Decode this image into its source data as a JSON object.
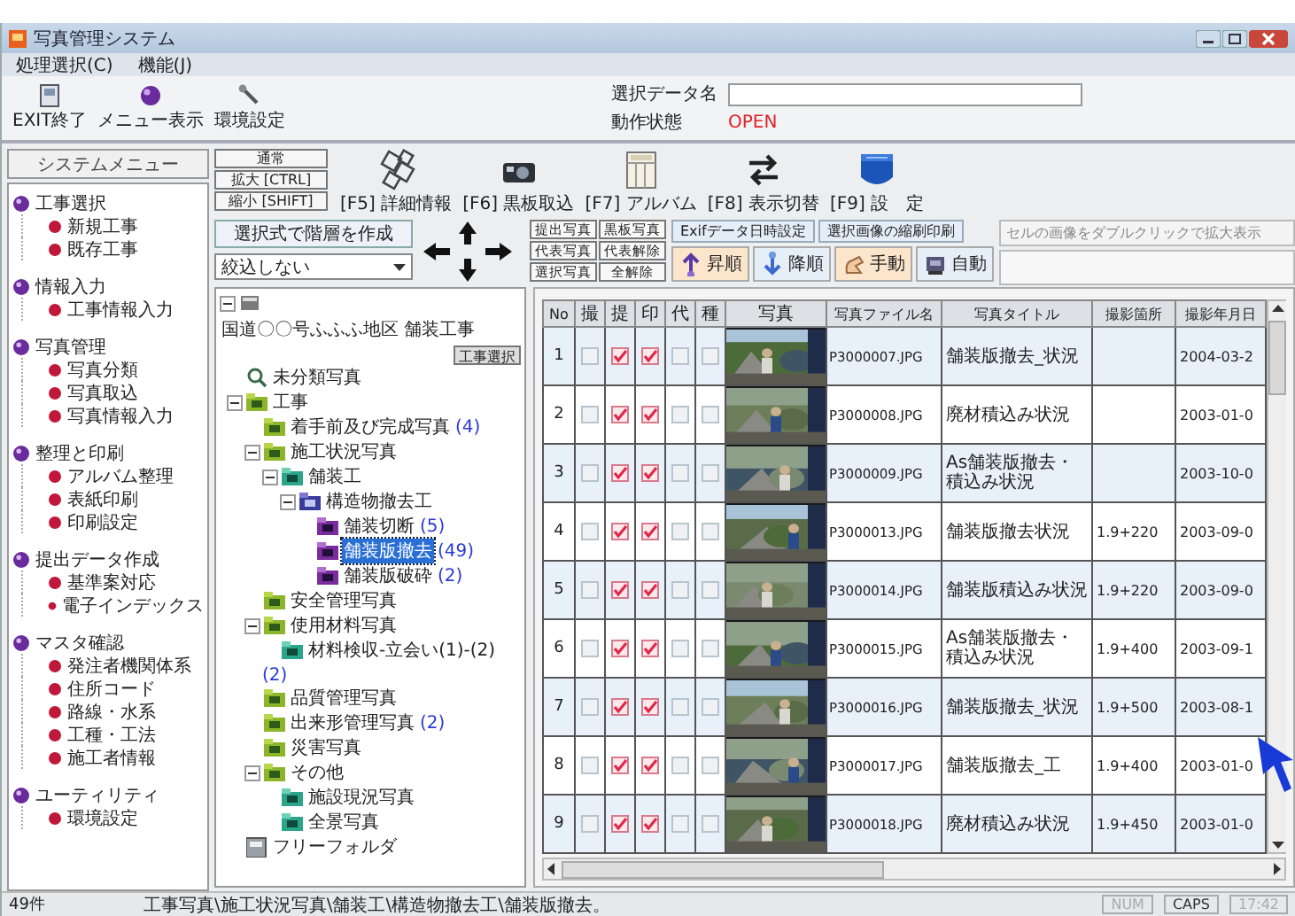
{
  "window": {
    "title": "写真管理システム"
  },
  "menu": [
    "処理選択(C)",
    "機能(J)"
  ],
  "toolbar": [
    {
      "label": "EXIT終了",
      "kind": "exit"
    },
    {
      "label": "メニュー表示",
      "kind": "menu"
    },
    {
      "label": "環境設定",
      "kind": "tools"
    }
  ],
  "selection": {
    "data_label": "選択データ名",
    "status_label": "動作状態",
    "status_value": "OPEN"
  },
  "sidebar": {
    "title": "システムメニュー",
    "groups": [
      {
        "label": "工事選択",
        "children": [
          "新規工事",
          "既存工事"
        ]
      },
      {
        "label": "情報入力",
        "children": [
          "工事情報入力"
        ]
      },
      {
        "label": "写真管理",
        "children": [
          "写真分類",
          "写真取込",
          "写真情報入力"
        ]
      },
      {
        "label": "整理と印刷",
        "children": [
          "アルバム整理",
          "表紙印刷",
          "印刷設定"
        ]
      },
      {
        "label": "提出データ作成",
        "children": [
          "基準案対応",
          "電子インデックス"
        ]
      },
      {
        "label": "マスタ確認",
        "children": [
          "発注者機関体系",
          "住所コード",
          "路線・水系",
          "工種・工法",
          "施工者情報"
        ]
      },
      {
        "label": "ユーティリティ",
        "children": [
          "環境設定"
        ]
      }
    ]
  },
  "view_buttons": [
    "通常",
    "拡大 [CTRL]",
    "縮小 [SHIFT]"
  ],
  "function_keys": [
    {
      "label": "[F5] 詳細情報",
      "kind": "detail"
    },
    {
      "label": "[F6] 黒板取込",
      "kind": "camera"
    },
    {
      "label": "[F7] アルバム",
      "kind": "album"
    },
    {
      "label": "[F8] 表示切替",
      "kind": "switch"
    },
    {
      "label": "[F9] 設　定",
      "kind": "settings"
    }
  ],
  "hierarchy_button": "選択式で階層を作成",
  "filter": {
    "value": "絞込しない"
  },
  "grid_buttons": [
    "提出写真",
    "黒板写真",
    "代表写真",
    "代表解除",
    "選択写真",
    "全解除"
  ],
  "action_buttons": [
    "Exifデータ日時設定",
    "選択画像の縮刷印刷"
  ],
  "hint": "セルの画像をダブルクリックで拡大表示",
  "sort_buttons": [
    {
      "label": "昇順",
      "kind": "up"
    },
    {
      "label": "降順",
      "kind": "down"
    },
    {
      "label": "手動",
      "kind": "hand"
    },
    {
      "label": "自動",
      "kind": "auto"
    }
  ],
  "tree": {
    "label": "国道〇〇号ふふふ地区 舗装工事",
    "kind": "project",
    "selected": false,
    "button": "工事選択",
    "children": [
      {
        "label": "未分類写真",
        "kind": "unsorted",
        "selected": false
      },
      {
        "label": "工事",
        "kind": "folder",
        "selected": false,
        "children": [
          {
            "label": "着手前及び完成写真",
            "count": "(4)",
            "kind": "folder",
            "selected": false
          },
          {
            "label": "施工状況写真",
            "kind": "folder",
            "selected": false,
            "children": [
              {
                "label": "舗装工",
                "kind": "work",
                "selected": false,
                "children": [
                  {
                    "label": "構造物撤去工",
                    "kind": "type",
                    "selected": false,
                    "children": [
                      {
                        "label": "舗装切断",
                        "count": "(5)",
                        "kind": "detail",
                        "selected": false
                      },
                      {
                        "label": "舗装版撤去",
                        "count": "(49)",
                        "kind": "detail",
                        "selected": true
                      },
                      {
                        "label": "舗装版破砕",
                        "count": "(2)",
                        "kind": "detail",
                        "selected": false
                      }
                    ]
                  }
                ]
              }
            ]
          },
          {
            "label": "安全管理写真",
            "kind": "folder",
            "selected": false
          },
          {
            "label": "使用材料写真",
            "kind": "folder",
            "selected": false,
            "children": [
              {
                "label": "材料検収-立会い(1)-(2)",
                "count": "(2)",
                "kind": "work",
                "selected": false
              }
            ]
          },
          {
            "label": "品質管理写真",
            "kind": "folder",
            "selected": false
          },
          {
            "label": "出来形管理写真",
            "count": "(2)",
            "kind": "folder",
            "selected": false
          },
          {
            "label": "災害写真",
            "kind": "folder",
            "selected": false
          },
          {
            "label": "その他",
            "kind": "folder",
            "selected": false,
            "children": [
              {
                "label": "施設現況写真",
                "kind": "work",
                "selected": false
              },
              {
                "label": "全景写真",
                "kind": "work",
                "selected": false
              }
            ]
          }
        ]
      },
      {
        "label": "フリーフォルダ",
        "kind": "free",
        "selected": false
      }
    ]
  },
  "table": {
    "columns": [
      "No",
      "撮",
      "提",
      "印",
      "代",
      "種",
      "写真",
      "写真ファイル名",
      "写真タイトル",
      "撮影箇所",
      "撮影年月日"
    ],
    "rows": [
      {
        "no": "1",
        "checks": [
          false,
          true,
          true,
          false,
          false
        ],
        "file": "P3000007.JPG",
        "title": "舗装版撤去_状況",
        "place": "",
        "date": "2004-03-2"
      },
      {
        "no": "2",
        "checks": [
          false,
          true,
          true,
          false,
          false
        ],
        "file": "P3000008.JPG",
        "title": "廃材積込み状況",
        "place": "",
        "date": "2003-01-0"
      },
      {
        "no": "3",
        "checks": [
          false,
          true,
          true,
          false,
          false
        ],
        "file": "P3000009.JPG",
        "title": "As舗装版撤去・積込み状況",
        "place": "",
        "date": "2003-10-0"
      },
      {
        "no": "4",
        "checks": [
          false,
          true,
          true,
          false,
          false
        ],
        "file": "P3000013.JPG",
        "title": "舗装版撤去状況",
        "place": "1.9+220",
        "date": "2003-09-0"
      },
      {
        "no": "5",
        "checks": [
          false,
          true,
          true,
          false,
          false
        ],
        "file": "P3000014.JPG",
        "title": "舗装版積込み状況",
        "place": "1.9+220",
        "date": "2003-09-0"
      },
      {
        "no": "6",
        "checks": [
          false,
          true,
          true,
          false,
          false
        ],
        "file": "P3000015.JPG",
        "title": "As舗装版撤去・積込み状況",
        "place": "1.9+400",
        "date": "2003-09-1"
      },
      {
        "no": "7",
        "checks": [
          false,
          true,
          true,
          false,
          false
        ],
        "file": "P3000016.JPG",
        "title": "舗装版撤去_状況",
        "place": "1.9+500",
        "date": "2003-08-1"
      },
      {
        "no": "8",
        "checks": [
          false,
          true,
          true,
          false,
          false
        ],
        "file": "P3000017.JPG",
        "title": "舗装版撤去_工",
        "place": "1.9+400",
        "date": "2003-01-0"
      },
      {
        "no": "9",
        "checks": [
          false,
          true,
          true,
          false,
          false
        ],
        "file": "P3000018.JPG",
        "title": "廃材積込み状況",
        "place": "1.9+450",
        "date": "2003-01-0"
      }
    ]
  },
  "status_bar": {
    "count": "49件",
    "message": "工事写真\\施工状況写真\\舗装工\\構造物撤去工\\舗装版撤去。",
    "indicators": [
      {
        "label": "NUM",
        "on": false
      },
      {
        "label": "CAPS",
        "on": true
      }
    ],
    "time": "17:42"
  }
}
